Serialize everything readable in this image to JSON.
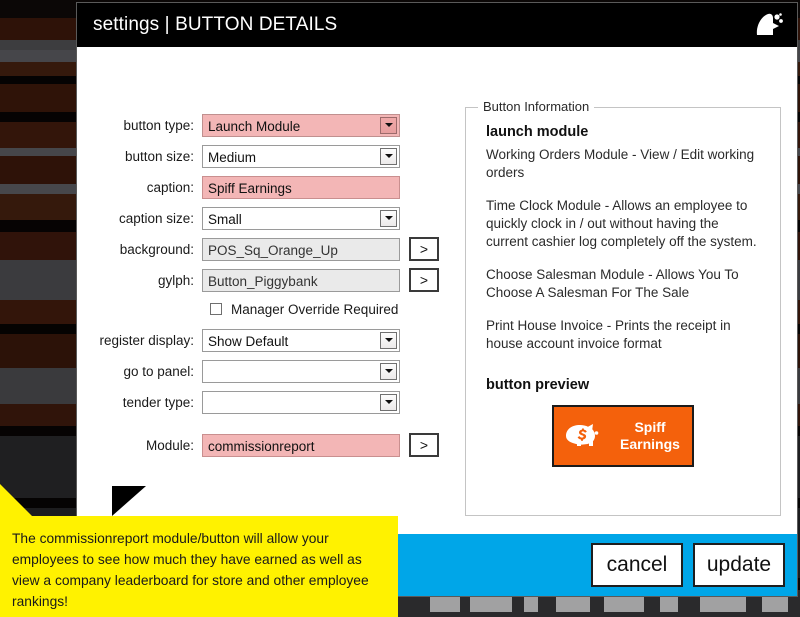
{
  "window": {
    "title_prefix": "settings",
    "title_separator": "|",
    "title_main": "BUTTON DETAILS",
    "title_full": "settings | BUTTON DETAILS",
    "logo_icon": "app-logo-icon",
    "titlebar_color": "#000000",
    "footer_color": "#00a6e8"
  },
  "form": {
    "fields": [
      {
        "label": "button type:",
        "value": "Launch Module",
        "control": "combobox",
        "highlight": true,
        "readonly": false
      },
      {
        "label": "button size:",
        "value": "Medium",
        "control": "combobox",
        "highlight": false,
        "readonly": false
      },
      {
        "label": "caption:",
        "value": "Spiff Earnings",
        "control": "textbox",
        "highlight": true,
        "readonly": false
      },
      {
        "label": "caption size:",
        "value": "Small",
        "control": "combobox",
        "highlight": false,
        "readonly": false
      },
      {
        "label": "background:",
        "value": "POS_Sq_Orange_Up",
        "control": "textbox",
        "highlight": false,
        "readonly": true,
        "browse": ">"
      },
      {
        "label": "gylph:",
        "value": "Button_Piggybank",
        "control": "textbox",
        "highlight": false,
        "readonly": true,
        "browse": ">"
      }
    ],
    "checkbox": {
      "label": "Manager Override Required",
      "checked": false
    },
    "fields2": [
      {
        "label": "register display:",
        "value": "Show Default",
        "control": "combobox",
        "highlight": false,
        "readonly": false
      },
      {
        "label": "go to panel:",
        "value": "",
        "control": "combobox",
        "highlight": false,
        "readonly": false
      },
      {
        "label": "tender type:",
        "value": "",
        "control": "combobox",
        "highlight": false,
        "readonly": false
      }
    ],
    "module_field": {
      "label": "Module:",
      "value": "commissionreport",
      "highlight": true,
      "browse": ">"
    }
  },
  "info_panel": {
    "legend": "Button Information",
    "heading": "launch module",
    "paragraphs": [
      "Working Orders Module - View / Edit working orders",
      "Time Clock Module - Allows an employee to quickly clock in / out without having the current cashier log completely off the system.",
      "Choose Salesman Module - Allows You To Choose A Salesman For The Sale",
      "Print House Invoice - Prints the receipt in house account invoice format"
    ],
    "preview_heading": "button preview",
    "preview": {
      "label": "Spiff\nEarnings",
      "label_line1": "Spiff",
      "label_line2": "Earnings",
      "background_color": "#f4610c",
      "glyph_icon": "piggybank-dollar-icon"
    }
  },
  "footer": {
    "cancel_label": "cancel",
    "update_label": "update"
  },
  "annotation": {
    "text": "The commissionreport module/button will allow your employees to see how much they have earned as well as view a company leaderboard for store and other employee rankings!",
    "background_color": "#fff200"
  }
}
